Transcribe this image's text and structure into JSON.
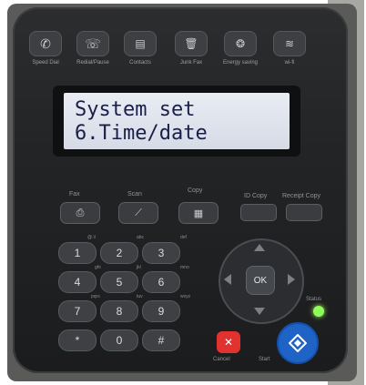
{
  "top_buttons": [
    {
      "label": "Speed Dial",
      "icon": "phone-icon"
    },
    {
      "label": "Redial/Pause",
      "icon": "phone-redial-icon"
    },
    {
      "label": "Contacts",
      "icon": "contacts-book-icon"
    },
    {
      "label": "Junk Fax",
      "icon": "trash-icon"
    },
    {
      "label": "Energy saving",
      "icon": "eco-icon"
    },
    {
      "label": "wi-fi",
      "icon": "wifi-icon"
    }
  ],
  "lcd": {
    "line1": "System set",
    "line2": "6.Time/date"
  },
  "mode_labels": {
    "fax": "Fax",
    "scan": "Scan",
    "copy": "Copy",
    "id_copy": "ID Copy",
    "receipt_copy": "Receipt Copy"
  },
  "keypad": {
    "keys": [
      "1",
      "2",
      "3",
      "4",
      "5",
      "6",
      "7",
      "8",
      "9",
      "*",
      "0",
      "#"
    ],
    "sublabels": [
      "@.\\/",
      "abc",
      "def",
      "ghi",
      "jkl",
      "mno",
      "pqrs",
      "tuv",
      "wxyz"
    ]
  },
  "nav": {
    "ok_label": "OK"
  },
  "status_label": "Status",
  "cancel_label": "Cancel",
  "start_label": "Start",
  "colors": {
    "start": "#1f63c6",
    "cancel": "#e1322f",
    "status_led": "#8dff5a",
    "lcd_text": "#1a1f4a"
  }
}
